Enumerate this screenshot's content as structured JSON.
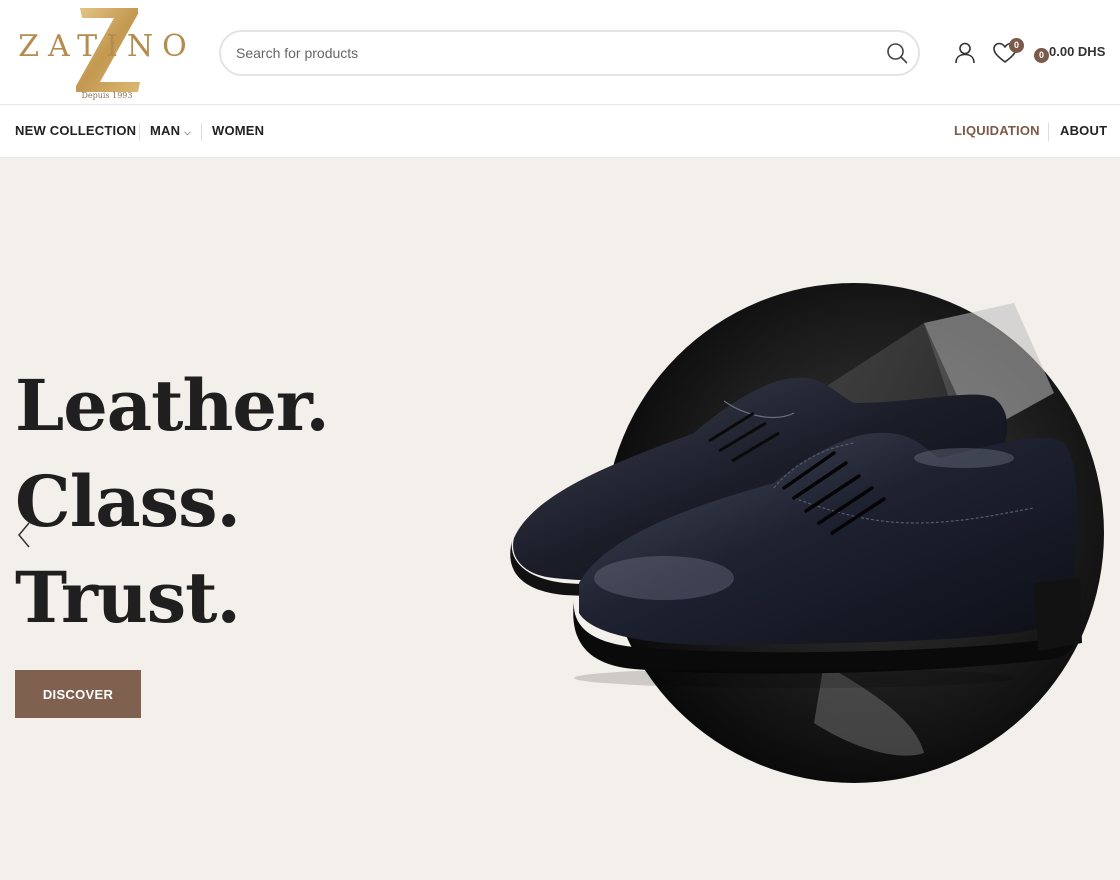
{
  "brand": {
    "name": "ZATINO",
    "monogram": "Z",
    "tagline": "Depuis 1993",
    "gold_color": "#c9a45c"
  },
  "search": {
    "placeholder": "Search for products"
  },
  "header_icons": {
    "account": "user-icon",
    "wishlist": "heart-icon",
    "wishlist_count": "0",
    "cart_count": "0",
    "cart_total": "0.00 DHS"
  },
  "nav": {
    "left": [
      {
        "label": "NEW COLLECTION"
      },
      {
        "label": "MAN",
        "has_dropdown": true
      },
      {
        "label": "WOMEN"
      }
    ],
    "right": [
      {
        "label": "LIQUIDATION"
      },
      {
        "label": "ABOUT"
      }
    ]
  },
  "hero": {
    "headline": [
      "Leather.",
      "Class.",
      "Trust."
    ],
    "cta_label": "DISCOVER",
    "cta_color": "#80604f",
    "background_color": "#f3efea",
    "prev_icon": "chevron-left-icon",
    "next_icon": "chevron-right-icon"
  },
  "colors": {
    "accent": "#7a5a49",
    "text": "#222222"
  }
}
